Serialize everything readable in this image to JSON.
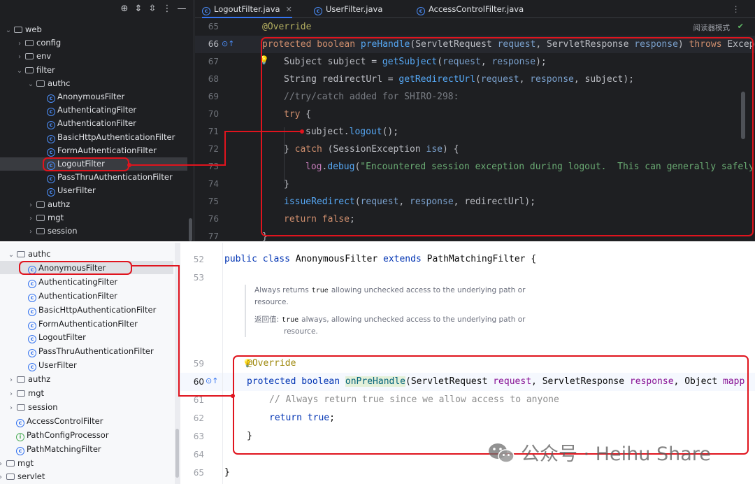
{
  "top": {
    "tabs": [
      {
        "label": "LogoutFilter.java",
        "active": true
      },
      {
        "label": "UserFilter.java",
        "active": false
      },
      {
        "label": "AccessControlFilter.java",
        "active": false
      }
    ],
    "tree": [
      {
        "label": "web",
        "kind": "folder",
        "open": true
      },
      {
        "label": "config",
        "kind": "folder",
        "open": false
      },
      {
        "label": "env",
        "kind": "folder",
        "open": false
      },
      {
        "label": "filter",
        "kind": "folder",
        "open": true
      },
      {
        "label": "authc",
        "kind": "folder",
        "open": true
      },
      {
        "label": "AnonymousFilter",
        "kind": "class"
      },
      {
        "label": "AuthenticatingFilter",
        "kind": "class"
      },
      {
        "label": "AuthenticationFilter",
        "kind": "class"
      },
      {
        "label": "BasicHttpAuthenticationFilter",
        "kind": "class"
      },
      {
        "label": "FormAuthenticationFilter",
        "kind": "class"
      },
      {
        "label": "LogoutFilter",
        "kind": "class",
        "selected": true
      },
      {
        "label": "PassThruAuthenticationFilter",
        "kind": "class"
      },
      {
        "label": "UserFilter",
        "kind": "class"
      },
      {
        "label": "authz",
        "kind": "folder",
        "open": false
      },
      {
        "label": "mgt",
        "kind": "folder",
        "open": false
      },
      {
        "label": "session",
        "kind": "folder",
        "open": false
      }
    ],
    "reader_mode": "阅读器模式",
    "line_numbers": [
      "65",
      "66",
      "67",
      "68",
      "69",
      "70",
      "71",
      "72",
      "73",
      "74",
      "75",
      "76",
      "77"
    ],
    "code": {
      "l65_annotation": "@Override",
      "l66_protected": "protected",
      "l66_boolean": "boolean",
      "l66_name": "preHandle",
      "l66_p1type": "ServletRequest",
      "l66_p1": "request",
      "l66_p2type": "ServletResponse",
      "l66_p2": "response",
      "l66_throws": "throws",
      "l66_exc": "Excep",
      "l67_type": "Subject",
      "l67_var": "subject",
      "l67_call": "getSubject",
      "l67_a1": "request",
      "l67_a2": "response",
      "l68_type": "String",
      "l68_var": "redirectUrl",
      "l68_call": "getRedirectUrl",
      "l68_a1": "request",
      "l68_a2": "response",
      "l68_a3": "subject",
      "l69_comment": "//try/catch added for SHIRO-298:",
      "l70_try": "try",
      "l71_obj": "subject",
      "l71_call": "logout",
      "l72_catch": "catch",
      "l72_type": "SessionException",
      "l72_var": "ise",
      "l73_field": "log",
      "l73_call": "debug",
      "l73_str": "\"Encountered session exception during logout.  This can generally safely",
      "l75_call": "issueRedirect",
      "l75_a1": "request",
      "l75_a2": "response",
      "l75_a3": "redirectUrl",
      "l76_return": "return",
      "l76_false": "false"
    }
  },
  "bottom": {
    "tree": [
      {
        "label": "authc",
        "kind": "folder",
        "open": true
      },
      {
        "label": "AnonymousFilter",
        "kind": "class",
        "selected": true
      },
      {
        "label": "AuthenticatingFilter",
        "kind": "class"
      },
      {
        "label": "AuthenticationFilter",
        "kind": "class"
      },
      {
        "label": "BasicHttpAuthenticationFilter",
        "kind": "class"
      },
      {
        "label": "FormAuthenticationFilter",
        "kind": "class"
      },
      {
        "label": "LogoutFilter",
        "kind": "class"
      },
      {
        "label": "PassThruAuthenticationFilter",
        "kind": "class"
      },
      {
        "label": "UserFilter",
        "kind": "class"
      },
      {
        "label": "authz",
        "kind": "folder",
        "open": false
      },
      {
        "label": "mgt",
        "kind": "folder",
        "open": false
      },
      {
        "label": "session",
        "kind": "folder",
        "open": false
      },
      {
        "label": "AccessControlFilter",
        "kind": "class"
      },
      {
        "label": "PathConfigProcessor",
        "kind": "interface"
      },
      {
        "label": "PathMatchingFilter",
        "kind": "class"
      },
      {
        "label": "mgt",
        "kind": "folder",
        "open": false
      },
      {
        "label": "servlet",
        "kind": "folder",
        "open": false
      }
    ],
    "line_numbers": [
      "52",
      "53",
      "59",
      "60",
      "61",
      "62",
      "63",
      "64",
      "65"
    ],
    "code": {
      "l52_public": "public",
      "l52_class": "class",
      "l52_name": "AnonymousFilter",
      "l52_extends": "extends",
      "l52_super": "PathMatchingFilter",
      "l59_annotation": "@Override",
      "l60_protected": "protected",
      "l60_boolean": "boolean",
      "l60_name": "onPreHandle",
      "l60_p1type": "ServletRequest",
      "l60_p1": "request",
      "l60_p2type": "ServletResponse",
      "l60_p2": "response",
      "l60_p3type": "Object",
      "l60_p3": "mapp",
      "l61_comment": "// Always return true since we allow access to anyone",
      "l62_return": "return",
      "l62_true": "true"
    },
    "doc": {
      "line1_pre": "Always returns",
      "line1_code": "true",
      "line1_post": "allowing unchecked access to the underlying path or",
      "line2": "resource.",
      "ret_label": "返回值:",
      "ret_code": "true",
      "ret_post": "always, allowing unchecked access to the underlying path or",
      "ret_line2": "resource."
    }
  },
  "watermark": {
    "text": "公众号 · Heihu Share"
  },
  "colors": {
    "annotation_red": "#e0141e",
    "dark_bg": "#1e1f22",
    "light_bg": "#ffffff",
    "keyword_dark": "#cf8e6d",
    "keyword_light": "#0033b3"
  }
}
